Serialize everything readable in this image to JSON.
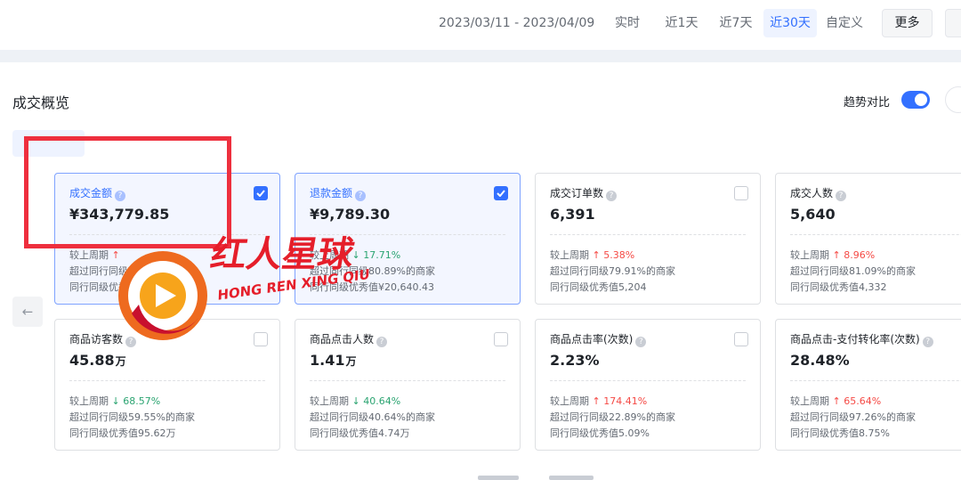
{
  "header": {
    "date_range": "2023/03/11 - 2023/04/09",
    "range_options": [
      "实时",
      "近1天",
      "近7天",
      "近30天",
      "自定义"
    ],
    "active_range": "近30天",
    "more_label": "更多"
  },
  "section": {
    "title": "成交概览",
    "trend_compare_label": "趋势对比",
    "trend_compare_on": true
  },
  "colors": {
    "accent": "#3370ff",
    "up": "#f54a45",
    "down": "#2ba471",
    "highlight_box": "#ee2f3e"
  },
  "icons": {
    "help": "question-circle-icon",
    "prev": "arrow-left-icon",
    "check": "checkmark-icon"
  },
  "cards": [
    {
      "title": "成交金额",
      "value": "¥343,779.85",
      "unit": "",
      "checked": true,
      "compare_label": "较上周期",
      "change": "↑",
      "change_dir": "up",
      "beat_text": "超过同行同级91.23%的商家",
      "peer_text": "同行同级优秀值¥282,12"
    },
    {
      "title": "退款金额",
      "value": "¥9,789.30",
      "unit": "",
      "checked": true,
      "compare_label": "较上周期",
      "change": "↓ 17.71%",
      "change_dir": "down",
      "beat_text": "超过同行同级80.89%的商家",
      "peer_text": "同行同级优秀值¥20,640.43"
    },
    {
      "title": "成交订单数",
      "value": "6,391",
      "unit": "",
      "checked": false,
      "compare_label": "较上周期",
      "change": "↑ 5.38%",
      "change_dir": "up",
      "beat_text": "超过同行同级79.91%的商家",
      "peer_text": "同行同级优秀值5,204"
    },
    {
      "title": "成交人数",
      "value": "5,640",
      "unit": "",
      "checked": false,
      "compare_label": "较上周期",
      "change": "↑ 8.96%",
      "change_dir": "up",
      "beat_text": "超过同行同级81.09%的商家",
      "peer_text": "同行同级优秀值4,332"
    },
    {
      "title": "商品访客数",
      "value": "45.88",
      "unit": "万",
      "checked": false,
      "compare_label": "较上周期",
      "change": "↓ 68.57%",
      "change_dir": "down",
      "beat_text": "超过同行同级59.55%的商家",
      "peer_text": "同行同级优秀值95.62万"
    },
    {
      "title": "商品点击人数",
      "value": "1.41",
      "unit": "万",
      "checked": false,
      "compare_label": "较上周期",
      "change": "↓ 40.64%",
      "change_dir": "down",
      "beat_text": "超过同行同级40.64%的商家",
      "peer_text": "同行同级优秀值4.74万"
    },
    {
      "title": "商品点击率(次数)",
      "value": "2.23%",
      "unit": "",
      "checked": false,
      "compare_label": "较上周期",
      "change": "↑ 174.41%",
      "change_dir": "up",
      "beat_text": "超过同行同级22.89%的商家",
      "peer_text": "同行同级优秀值5.09%"
    },
    {
      "title": "商品点击-支付转化率(次数)",
      "value": "28.48%",
      "unit": "",
      "checked": false,
      "compare_label": "较上周期",
      "change": "↑ 65.64%",
      "change_dir": "up",
      "beat_text": "超过同行同级97.26%的商家",
      "peer_text": "同行同级优秀值8.75%"
    }
  ],
  "watermark": {
    "brand_cn": "红人星球",
    "brand_en": "HONG REN XING QIU"
  }
}
